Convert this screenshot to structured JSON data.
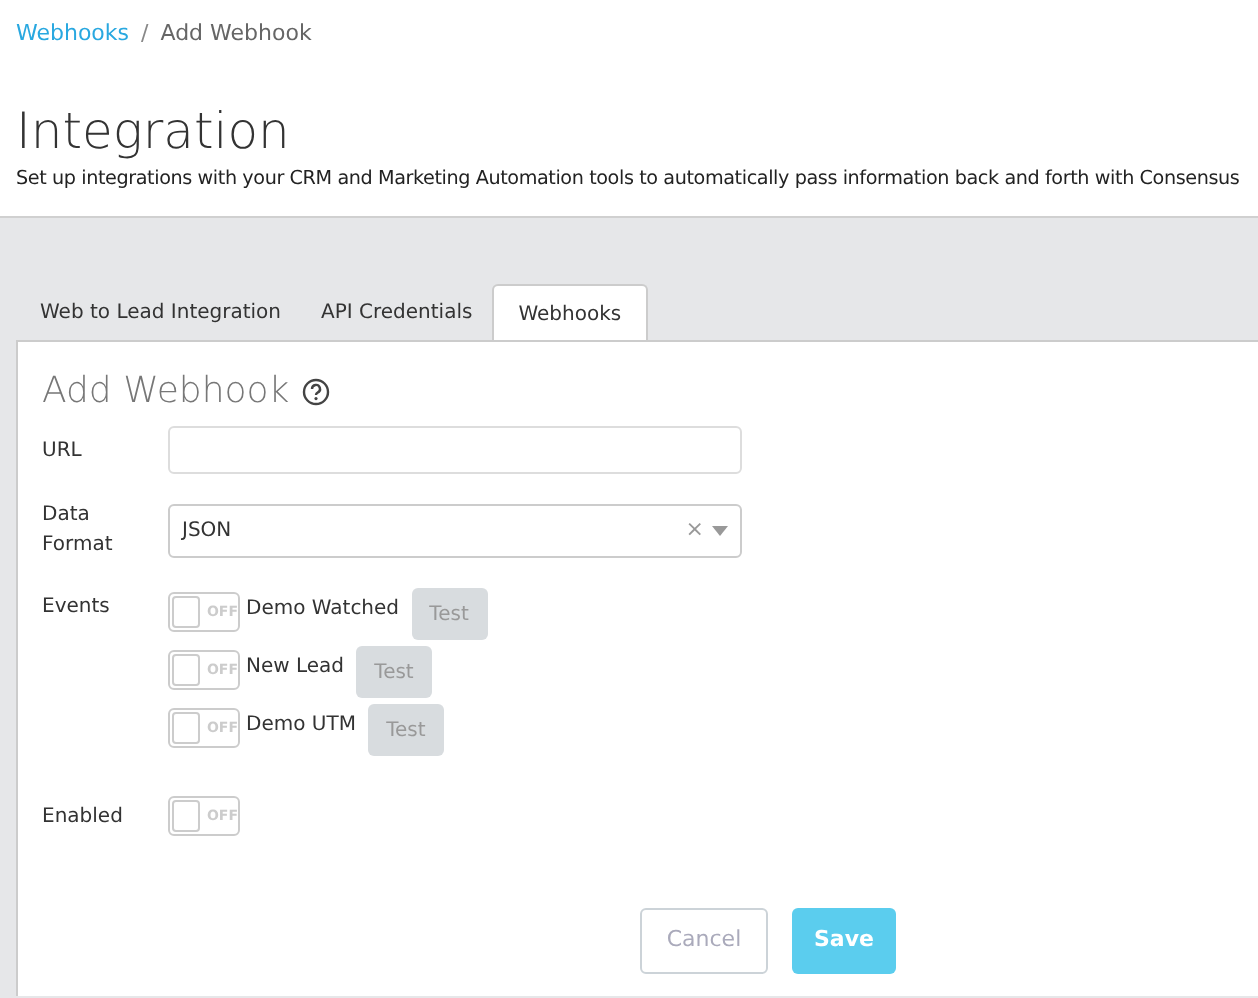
{
  "breadcrumb": [
    {
      "label": "Webhooks",
      "kind": "link"
    },
    {
      "label": "/",
      "kind": "separator"
    },
    {
      "label": "Add Webhook",
      "kind": "current"
    }
  ],
  "title": "Integration",
  "subtitle": "Set up integrations with your CRM and Marketing Automation tools to automatically pass information back and forth with Consensus",
  "tabs": [
    {
      "label": "Web to Lead Integration",
      "selected": false
    },
    {
      "label": "API Credentials",
      "selected": false
    },
    {
      "label": "Webhooks",
      "selected": true
    }
  ],
  "form": {
    "heading": "Add Webhook",
    "url": {
      "label": "URL"
    },
    "data_format": {
      "label": "Data Format",
      "value": "JSON",
      "clear": "×"
    },
    "events": {
      "label": "Events",
      "items": [
        {
          "name": "Demo Watched",
          "on": false,
          "toggle_text": "OFF",
          "test": "Test"
        },
        {
          "name": "New Lead",
          "on": false,
          "toggle_text": "OFF",
          "test": "Test"
        },
        {
          "name": "Demo UTM",
          "on": false,
          "toggle_text": "OFF",
          "test": "Test"
        }
      ]
    },
    "enabled": {
      "label": "Enabled",
      "on": false,
      "toggle_text": "OFF"
    },
    "buttons": [
      {
        "label": "Cancel",
        "kind": "secondary"
      },
      {
        "label": "Save",
        "kind": "primary"
      }
    ]
  }
}
